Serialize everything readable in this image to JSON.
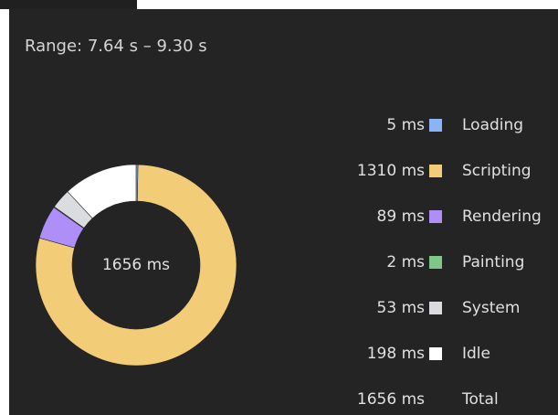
{
  "range": {
    "label": "Range: 7.64 s – 9.30 s"
  },
  "donut": {
    "center_label": "1656 ms"
  },
  "legend": [
    {
      "value": "5 ms",
      "label": "Loading",
      "color": "#8ab4f8",
      "ms": 5
    },
    {
      "value": "1310 ms",
      "label": "Scripting",
      "color": "#f3cc78",
      "ms": 1310
    },
    {
      "value": "89 ms",
      "label": "Rendering",
      "color": "#ae8ff7",
      "ms": 89
    },
    {
      "value": "2 ms",
      "label": "Painting",
      "color": "#80c68a",
      "ms": 2
    },
    {
      "value": "53 ms",
      "label": "System",
      "color": "#dadce0",
      "ms": 53
    },
    {
      "value": "198 ms",
      "label": "Idle",
      "color": "#ffffff",
      "ms": 198
    }
  ],
  "total": {
    "value": "1656 ms",
    "label": "Total"
  }
}
